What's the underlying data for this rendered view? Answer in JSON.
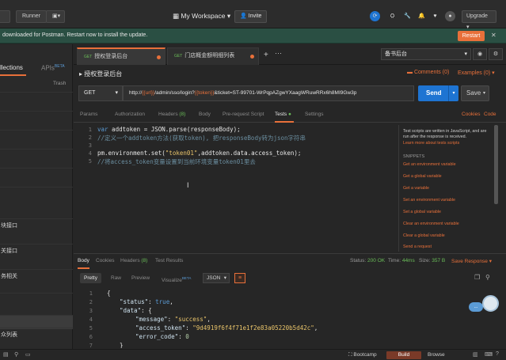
{
  "topbar": {
    "btn1": "",
    "runner": "Runner",
    "btn3": "",
    "workspace": "My Workspace",
    "invite": "Invite",
    "upgrade": "Upgrade"
  },
  "banner": {
    "text": "downloaded for Postman. Restart now to install the update.",
    "restart": "Restart"
  },
  "sidebar": {
    "collections": "llections",
    "apis": "APIs",
    "apis_badge": "BETA",
    "trash": "Trash",
    "items": [
      {
        "label": ""
      },
      {
        "label": ""
      },
      {
        "label": ""
      },
      {
        "label": ""
      },
      {
        "label": ""
      },
      {
        "label": ""
      },
      {
        "label": "块接口"
      },
      {
        "label": "关接口"
      },
      {
        "label": "务相关"
      },
      {
        "label": ""
      },
      {
        "label": ""
      },
      {
        "label": "众列表"
      }
    ]
  },
  "tabs": [
    {
      "method": "GET",
      "label": "授权登录后台",
      "active": true
    },
    {
      "method": "GET",
      "label": "门店概金额明细列表",
      "active": false
    }
  ],
  "environment": "备书后台",
  "request": {
    "title": "授权登录后台",
    "comments_label": "Comments (0)",
    "examples_label": "Examples (0)",
    "method": "GET",
    "url_prefix": "http://",
    "url_var1": "{{url}}",
    "url_mid": "/admin/sso/login?",
    "url_var2": "{{token}}",
    "url_suffix": "&ticket=ST-99701-WrPqpAZgwYXaagWRuwRRx6h8MI9Gw3p",
    "send": "Send",
    "save": "Save"
  },
  "subtabs": {
    "params": "Params",
    "authorization": "Authorization",
    "headers": "Headers",
    "headers_count": "(8)",
    "body": "Body",
    "prerequest": "Pre-request Script",
    "tests": "Tests",
    "settings": "Settings",
    "cookies": "Cookies",
    "code": "Code"
  },
  "editor": {
    "line_numbers": [
      "1",
      "2",
      "3",
      "4",
      "5"
    ],
    "l1": {
      "kw": "var",
      "id": " addtoken = JSON.parse(responseBody);"
    },
    "l2": "//定义一个addtoken方法(获取token), 把responseBody转为json字符串",
    "l4_a": "pm.environment.set(",
    "l4_str": "\"token01\"",
    "l4_b": ",addtoken.data.access_token);",
    "l5": "//将access_token变量设置到当前环境变量token01里去"
  },
  "snippets": {
    "description": "Test scripts are written in JavaScript, and are run after the response is received.",
    "learn_more": "Learn more about tests scripts",
    "heading": "SNIPPETS",
    "items": [
      "Get an environment variable",
      "Get a global variable",
      "Get a variable",
      "Set an environment variable",
      "Set a global variable",
      "Clear an environment variable",
      "Clear a global variable",
      "Send a request"
    ]
  },
  "response": {
    "tabs": {
      "body": "Body",
      "cookies": "Cookies",
      "headers": "Headers",
      "headers_count": "(8)",
      "test_results": "Test Results"
    },
    "status_label": "Status:",
    "status_value": "200 OK",
    "time_label": "Time:",
    "time_value": "44ms",
    "size_label": "Size:",
    "size_value": "357 B",
    "save_response": "Save Response ▾",
    "format": {
      "pretty": "Pretty",
      "raw": "Raw",
      "preview": "Preview",
      "visualize": "Visualize",
      "visualize_badge": "BETA",
      "type": "JSON"
    },
    "line_numbers": [
      "1",
      "2",
      "3",
      "4",
      "5",
      "6",
      "7"
    ],
    "json": {
      "status_key": "\"status\"",
      "status_val": "true",
      "data_key": "\"data\"",
      "message_key": "\"message\"",
      "message_val": "\"success\"",
      "token_key": "\"access_token\"",
      "token_val": "\"9d4919f6f4f71e1f2e83a05220b5d42c\"",
      "error_key": "\"error_code\"",
      "error_val": "0"
    }
  },
  "statusbar": {
    "bootcamp": "Bootcamp",
    "build": "Build",
    "browse": "Browse"
  },
  "bubble": "..."
}
